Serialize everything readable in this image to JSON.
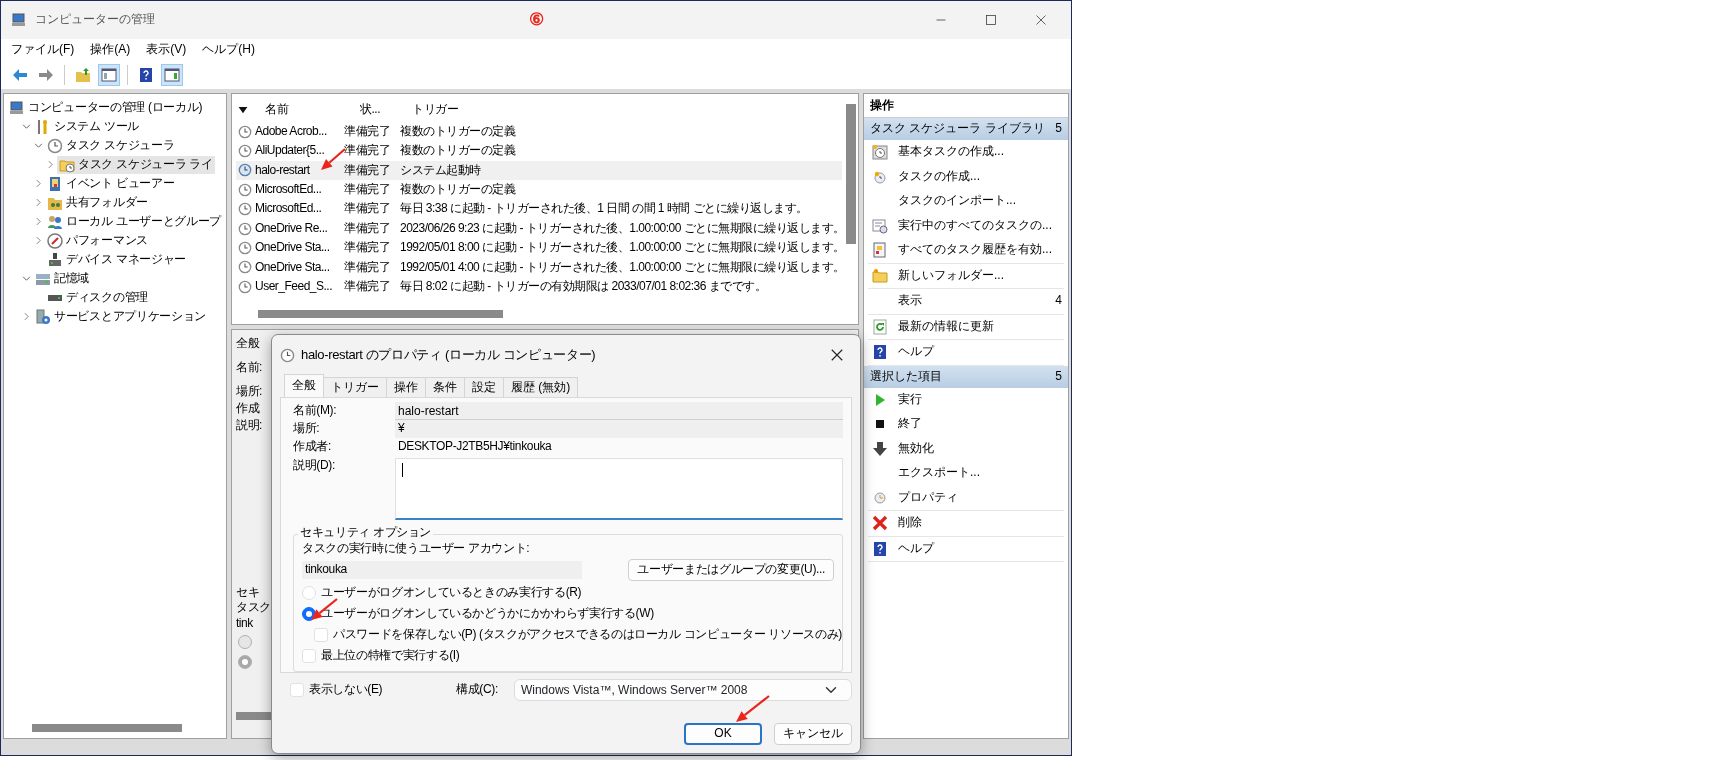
{
  "window": {
    "title": "コンピューターの管理",
    "annotation": "⑥"
  },
  "menu": [
    "ファイル(F)",
    "操作(A)",
    "表示(V)",
    "ヘルプ(H)"
  ],
  "toolbar": [
    {
      "kind": "back",
      "on": false
    },
    {
      "kind": "forward",
      "on": false
    },
    {
      "kind": "up",
      "on": false
    },
    {
      "kind": "tree-pane",
      "on": true
    },
    {
      "kind": "help",
      "on": false
    },
    {
      "kind": "action-pane",
      "on": true
    }
  ],
  "tree": [
    {
      "label": "コンピューターの管理 (ローカル)",
      "kind": "computer",
      "selected": false,
      "children": [
        {
          "label": "システム ツール",
          "kind": "tools",
          "expanded": true,
          "selected": false,
          "children": [
            {
              "label": "タスク スケジューラ",
              "kind": "clock",
              "expanded": true,
              "selected": false,
              "children": [
                {
                  "label": "タスク スケジューラ ライ",
                  "kind": "folder-clock",
                  "expanded": false,
                  "selected": true
                }
              ]
            },
            {
              "label": "イベント ビューアー",
              "kind": "log",
              "expanded": false,
              "selected": false
            },
            {
              "label": "共有フォルダー",
              "kind": "share",
              "expanded": false,
              "selected": false
            },
            {
              "label": "ローカル ユーザーとグループ",
              "kind": "users",
              "expanded": false,
              "selected": false
            },
            {
              "label": "パフォーマンス",
              "kind": "gauge",
              "expanded": false,
              "selected": false
            },
            {
              "label": "デバイス マネージャー",
              "kind": "device",
              "selected": false
            }
          ]
        },
        {
          "label": "記憶域",
          "kind": "storage",
          "expanded": true,
          "selected": false,
          "children": [
            {
              "label": "ディスクの管理",
              "kind": "disk",
              "selected": false
            }
          ]
        },
        {
          "label": "サービスとアプリケーション",
          "kind": "services",
          "expanded": false,
          "selected": false
        }
      ]
    }
  ],
  "task_list": {
    "columns": [
      "名前",
      "状...",
      "トリガー"
    ],
    "rows": [
      {
        "name": "Adobe Acrob...",
        "status": "準備完了",
        "trigger": "複数のトリガーの定義",
        "selected": false
      },
      {
        "name": "AliUpdater{5...",
        "status": "準備完了",
        "trigger": "複数のトリガーの定義",
        "selected": false
      },
      {
        "name": "halo-restart",
        "status": "準備完了",
        "trigger": "システム起動時",
        "selected": true
      },
      {
        "name": "MicrosoftEd...",
        "status": "準備完了",
        "trigger": "複数のトリガーの定義",
        "selected": false
      },
      {
        "name": "MicrosoftEd...",
        "status": "準備完了",
        "trigger": "毎日 3:38 に起動 - トリガーされた後、1 日間 の間 1 時間 ごとに繰り返します。",
        "selected": false
      },
      {
        "name": "OneDrive Re...",
        "status": "準備完了",
        "trigger": "2023/06/26 9:23 に起動 - トリガーされた後、1.00:00:00 ごとに無期限に繰り返します。",
        "selected": false
      },
      {
        "name": "OneDrive Sta...",
        "status": "準備完了",
        "trigger": "1992/05/01 8:00 に起動 - トリガーされた後、1.00:00:00 ごとに無期限に繰り返します。",
        "selected": false
      },
      {
        "name": "OneDrive Sta...",
        "status": "準備完了",
        "trigger": "1992/05/01 4:00 に起動 - トリガーされた後、1.00:00:00 ごとに無期限に繰り返します。",
        "selected": false
      },
      {
        "name": "User_Feed_S...",
        "status": "準備完了",
        "trigger": "毎日 8:02 に起動 - トリガーの有効期限は 2033/07/01 8:02:36 までです。",
        "selected": false
      }
    ]
  },
  "detail_pane": {
    "tab": "全般",
    "labels": [
      "名前:",
      "場所:",
      "作成",
      "説明:"
    ],
    "security_title": "セキ",
    "account_label": "タスク",
    "account": "tink",
    "radios": [
      {
        "selected": false
      },
      {
        "selected": true
      }
    ]
  },
  "actions": {
    "title": "操作",
    "sections": [
      {
        "title": "タスク スケジューラ ライブラリ",
        "marker": "5",
        "groups": [
          [
            {
              "label": "基本タスクの作成...",
              "kind": "basic-task"
            },
            {
              "label": "タスクの作成...",
              "kind": "create-task"
            },
            {
              "label": "タスクのインポート...",
              "kind": "none"
            },
            {
              "label": "実行中のすべてのタスクの...",
              "kind": "running"
            },
            {
              "label": "すべてのタスク履歴を有効...",
              "kind": "history"
            }
          ],
          [
            {
              "label": "新しいフォルダー...",
              "kind": "new-folder"
            }
          ],
          [
            {
              "label": "表示",
              "kind": "none",
              "submenu": "4"
            }
          ],
          [
            {
              "label": "最新の情報に更新",
              "kind": "refresh"
            }
          ],
          [
            {
              "label": "ヘルプ",
              "kind": "help"
            }
          ]
        ]
      },
      {
        "title": "選択した項目",
        "marker": "5",
        "groups": [
          [
            {
              "label": "実行",
              "kind": "run"
            },
            {
              "label": "終了",
              "kind": "stop"
            },
            {
              "label": "無効化",
              "kind": "disable"
            },
            {
              "label": "エクスポート...",
              "kind": "none"
            },
            {
              "label": "プロパティ",
              "kind": "properties"
            }
          ],
          [
            {
              "label": "削除",
              "kind": "delete"
            }
          ],
          [
            {
              "label": "ヘルプ",
              "kind": "help"
            }
          ]
        ]
      }
    ]
  },
  "dialog": {
    "title": "halo-restart のプロパティ (ローカル コンピューター)",
    "tabs": [
      {
        "label": "全般",
        "selected": true
      },
      {
        "label": "トリガー",
        "selected": false
      },
      {
        "label": "操作",
        "selected": false
      },
      {
        "label": "条件",
        "selected": false
      },
      {
        "label": "設定",
        "selected": false
      },
      {
        "label": "履歴 (無効)",
        "selected": false
      }
    ],
    "fields": [
      {
        "label": "名前(M):",
        "value": "halo-restart",
        "kind": "input"
      },
      {
        "label": "場所:",
        "value": "¥",
        "kind": "readonly"
      },
      {
        "label": "作成者:",
        "value": "DESKTOP-J2TB5HJ¥tinkouka",
        "kind": "text"
      },
      {
        "label": "説明(D):",
        "kind": "textarea",
        "focused": true
      }
    ],
    "security": {
      "title": "セキュリティ オプション",
      "account_label": "タスクの実行時に使うユーザー アカウント:",
      "account": "tinkouka",
      "change_button": "ユーザーまたはグループの変更(U)...",
      "radios": [
        {
          "label": "ユーザーがログオンしているときのみ実行する(R)",
          "selected": false
        },
        {
          "label": "ユーザーがログオンしているかどうかにかかわらず実行する(W)",
          "selected": true,
          "children": [
            {
              "label": "パスワードを保存しない(P) (タスクがアクセスできるのはローカル コンピューター リソースのみ)",
              "checked": false
            }
          ]
        }
      ],
      "highest": {
        "label": "最上位の特権で実行する(I)",
        "checked": false
      }
    },
    "hidden": {
      "label": "表示しない(E)",
      "checked": false
    },
    "config_label": "構成(C):",
    "config_value": "Windows Vista™, Windows Server™ 2008",
    "buttons": [
      {
        "label": "OK",
        "kind": "default"
      },
      {
        "label": "キャンセル",
        "kind": "normal"
      }
    ]
  }
}
